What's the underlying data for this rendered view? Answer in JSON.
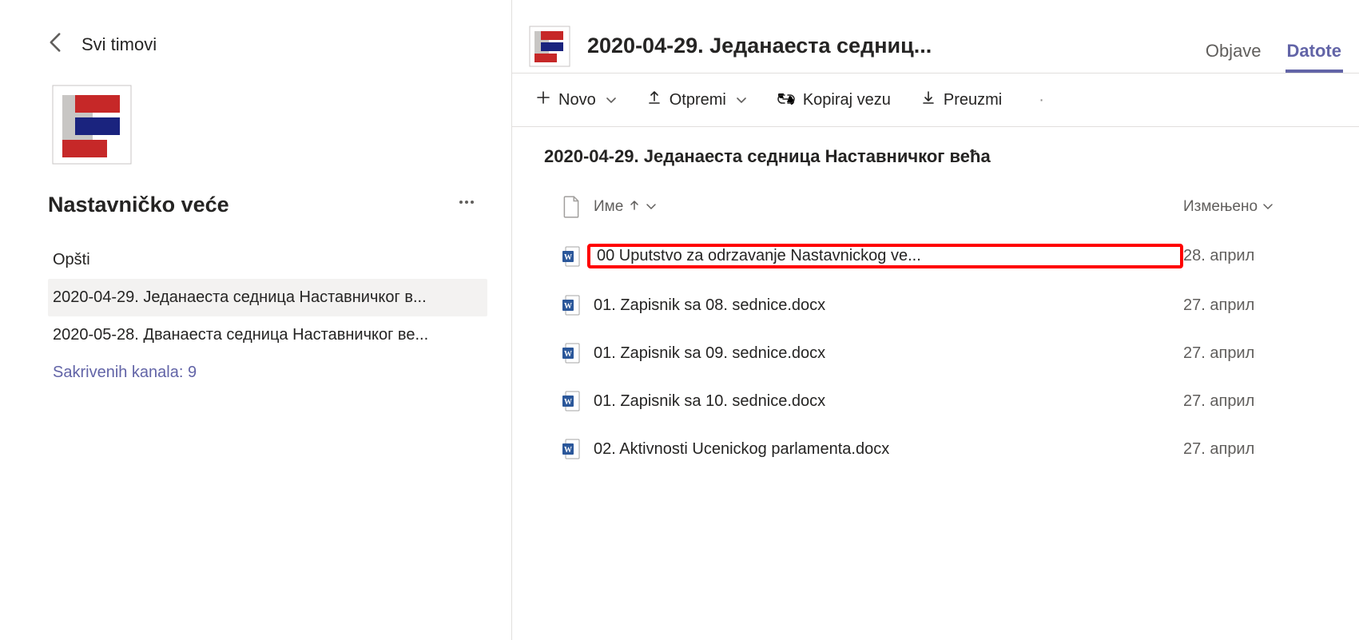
{
  "sidebar": {
    "back_label": "Svi timovi",
    "team_name": "Nastavničko veće",
    "channels": [
      {
        "label": "Opšti",
        "selected": false
      },
      {
        "label": "2020-04-29. Једанаеста седница Наставничког в...",
        "selected": true
      },
      {
        "label": "2020-05-28. Дванаеста седница Наставничког ве...",
        "selected": false
      }
    ],
    "hidden_label": "Sakrivenih kanala: 9"
  },
  "header": {
    "title": "2020-04-29. Једанаеста седниц...",
    "tabs": [
      {
        "label": "Objave",
        "active": false
      },
      {
        "label": "Datote",
        "active": true
      }
    ]
  },
  "toolbar": {
    "new_label": "Novo",
    "upload_label": "Otpremi",
    "copy_link_label": "Kopiraj vezu",
    "download_label": "Preuzmi"
  },
  "breadcrumb": "2020-04-29. Једанаеста седница Наставничког већа",
  "columns": {
    "name_label": "Име",
    "modified_label": "Измењено"
  },
  "files": [
    {
      "name": "00 Uputstvo za odrzavanje Nastavnickog ve...",
      "modified": "28. април",
      "highlight": true
    },
    {
      "name": "01. Zapisnik sa 08. sednice.docx",
      "modified": "27. април",
      "highlight": false
    },
    {
      "name": "01. Zapisnik sa 09. sednice.docx",
      "modified": "27. април",
      "highlight": false
    },
    {
      "name": "01. Zapisnik sa 10. sednice.docx",
      "modified": "27. април",
      "highlight": false
    },
    {
      "name": "02. Aktivnosti Ucenickog parlamenta.docx",
      "modified": "27. април",
      "highlight": false
    }
  ]
}
